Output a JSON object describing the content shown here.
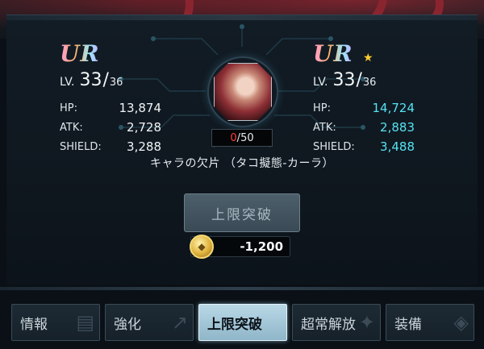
{
  "left": {
    "rarity": "UR",
    "level_label": "LV.",
    "level_current": "33",
    "level_max": "36",
    "stats": [
      {
        "key": "HP:",
        "value": "13,874"
      },
      {
        "key": "ATK:",
        "value": "2,728"
      },
      {
        "key": "SHIELD:",
        "value": "3,288"
      }
    ]
  },
  "right": {
    "rarity": "UR",
    "star": "★",
    "level_label": "LV.",
    "level_current": "33",
    "level_max": "36",
    "stats": [
      {
        "key": "HP:",
        "value": "14,724"
      },
      {
        "key": "ATK:",
        "value": "2,883"
      },
      {
        "key": "SHIELD:",
        "value": "3,488"
      }
    ]
  },
  "shard": {
    "count_current": "0",
    "count_max": "50",
    "name": "キャラの欠片 （タコ擬態-カーラ）"
  },
  "limit_break_button": "上限突破",
  "cost": "-1,200",
  "tabs": [
    {
      "label": "情報",
      "icon": "info-icon",
      "active": false
    },
    {
      "label": "強化",
      "icon": "level-up-icon",
      "active": false
    },
    {
      "label": "上限突破",
      "icon": "limit-break-icon",
      "active": true
    },
    {
      "label": "超常解放",
      "icon": "release-icon",
      "active": false
    },
    {
      "label": "装備",
      "icon": "equipment-icon",
      "active": false
    }
  ],
  "colors": {
    "accent_cyan": "#55e3f2",
    "shard_counter_red": "#ff3c3c",
    "active_tab": "#b9d8e6"
  }
}
